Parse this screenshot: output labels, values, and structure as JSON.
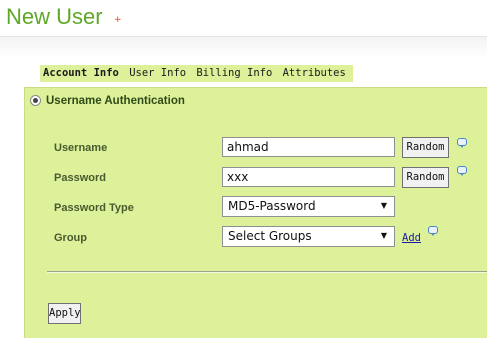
{
  "page": {
    "title": "New User",
    "title_plus": "+"
  },
  "tabs": [
    {
      "label": "Account Info",
      "active": true
    },
    {
      "label": "User Info",
      "active": false
    },
    {
      "label": "Billing Info",
      "active": false
    },
    {
      "label": "Attributes",
      "active": false
    }
  ],
  "auth": {
    "heading": "Username Authentication",
    "selected": true
  },
  "form": {
    "username_label": "Username",
    "username_value": "ahmad",
    "password_label": "Password",
    "password_value": "xxx",
    "password_type_label": "Password Type",
    "password_type_value": "MD5-Password",
    "group_label": "Group",
    "group_value": "Select Groups",
    "random_label": "Random",
    "add_label": "Add"
  },
  "actions": {
    "apply_label": "Apply"
  },
  "colors": {
    "title_green": "#5fa827",
    "panel_bg": "#ddf09a",
    "link_blue": "#1a1aa0",
    "plus_red": "#e0401f"
  }
}
